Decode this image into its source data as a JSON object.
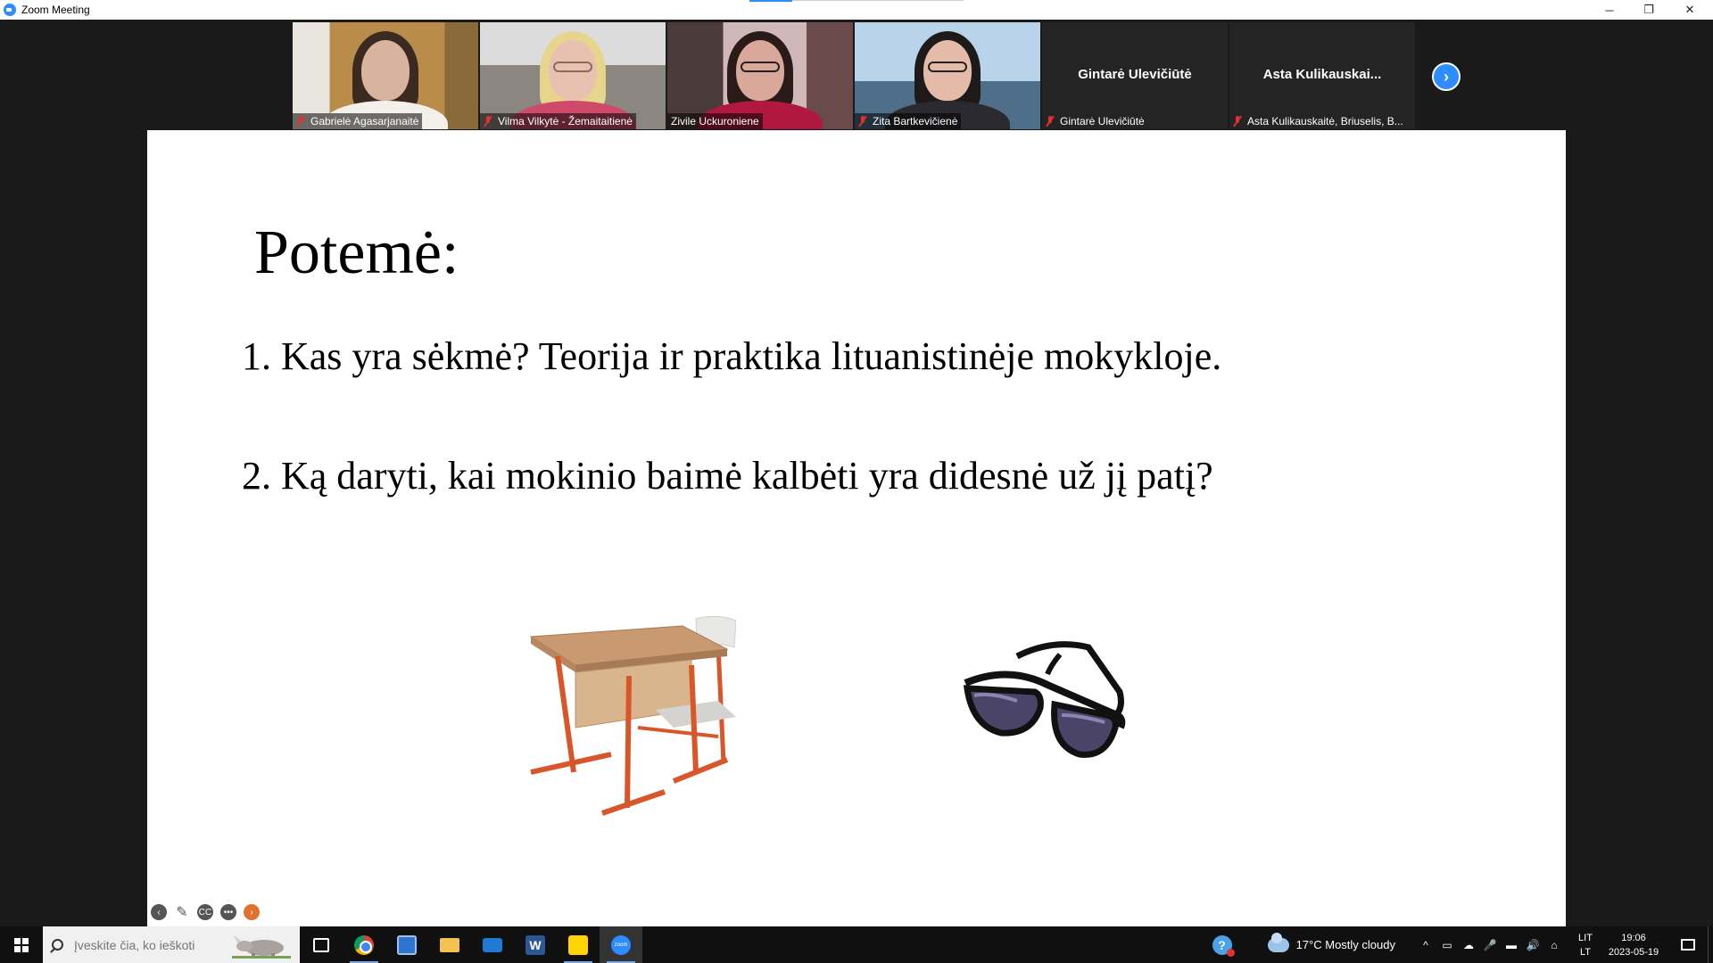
{
  "window": {
    "title": "Zoom Meeting",
    "controls": {
      "minimize": "─",
      "maximize": "❐",
      "close": "✕"
    }
  },
  "participants": [
    {
      "name": "Gabrielė Agasarjanaitė",
      "muted": true,
      "video": true,
      "active": false
    },
    {
      "name": "Vilma Vilkytė - Žemaitaitienė",
      "muted": true,
      "video": true,
      "active": false
    },
    {
      "name": "Zivile Uckuroniene",
      "muted": false,
      "video": true,
      "active": true
    },
    {
      "name": "Zita Bartkevičienė",
      "muted": true,
      "video": true,
      "active": false
    },
    {
      "name": "Gintarė Ulevičiūtė",
      "display_name": "Gintarė Ulevičiūtė",
      "muted": true,
      "video": false,
      "active": false
    },
    {
      "name": "Asta Kulikauskaitė, Briuselis, B...",
      "display_name": "Asta  Kulikauskai...",
      "muted": true,
      "video": false,
      "active": false
    }
  ],
  "strip": {
    "next_icon": "chevron-right-icon",
    "next_glyph": "›"
  },
  "slide": {
    "title": "Potemė:",
    "points": [
      "1. Kas yra sėkmė? Teorija ir praktika lituanistinėje mokykloje.",
      "2. Ką daryti, kai mokinio baimė kalbėti yra didesnė už jį patį?"
    ],
    "images": [
      "school-desk-image",
      "sunglasses-image"
    ],
    "tools": {
      "back": "‹",
      "pen": "✎",
      "cc": "CC",
      "more": "•••",
      "next": "›"
    }
  },
  "taskbar": {
    "search_placeholder": "Įveskite čia, ko ieškoti",
    "apps": [
      "task-view",
      "chrome",
      "microsoft-store",
      "file-explorer",
      "mail",
      "word",
      "sticky-notes",
      "zoom"
    ],
    "word_glyph": "W",
    "zoom_glyph": "zoom",
    "help_glyph": "?",
    "weather": "17°C  Mostly cloudy",
    "tray_glyphs": [
      "^",
      "▭",
      "☁",
      "🎤",
      "▬",
      "🔊",
      "⌂"
    ],
    "lang": [
      "LIT",
      "LT"
    ],
    "time": "19:06",
    "date": "2023-05-19"
  },
  "colors": {
    "zoom_blue": "#2d8cff",
    "active_speaker": "#a8c83a",
    "muted_red": "#e0322d"
  }
}
